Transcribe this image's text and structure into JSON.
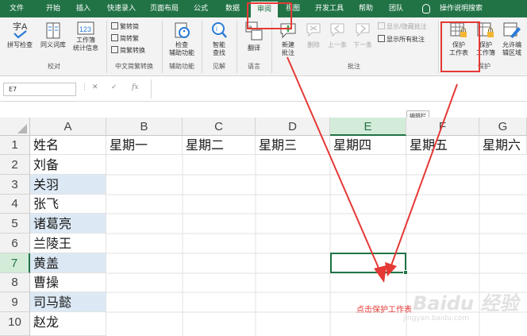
{
  "tabs": [
    {
      "label": "文件"
    },
    {
      "label": "开始"
    },
    {
      "label": "插入"
    },
    {
      "label": "快速录入"
    },
    {
      "label": "页面布局"
    },
    {
      "label": "公式"
    },
    {
      "label": "数据"
    },
    {
      "label": "审阅"
    },
    {
      "label": "视图"
    },
    {
      "label": "开发工具"
    },
    {
      "label": "帮助"
    },
    {
      "label": "团队"
    }
  ],
  "search_label": "操作说明搜索",
  "ribbon": {
    "spellcheck": "拼写检查",
    "thesaurus": "同义词库",
    "wordcount_line1": "工作簿",
    "wordcount_line2": "统计信息",
    "group_proofing": "校对",
    "to_simplified": "繁转简",
    "to_traditional": "简转繁",
    "convert": "简繁转换",
    "group_chinese": "中文简繁转换",
    "check_a11y_line1": "检查",
    "check_a11y_line2": "辅助功能",
    "group_a11y": "辅助功能",
    "smart_lookup_line1": "智能",
    "smart_lookup_line2": "查找",
    "group_insights": "见解",
    "translate": "翻译",
    "group_language": "语言",
    "new_comment_line1": "新建",
    "new_comment_line2": "批注",
    "delete": "删除",
    "prev": "上一条",
    "next": "下一条",
    "show_hide_comment": "显示/隐藏批注",
    "show_all_comments": "显示所有批注",
    "group_comments": "批注",
    "protect_sheet_line1": "保护",
    "protect_sheet_line2": "工作表",
    "protect_wb_line1": "保护",
    "protect_wb_line2": "工作簿",
    "allow_edit_line1": "允许编",
    "allow_edit_line2": "辑区域",
    "group_protect": "保护"
  },
  "formula_bar": {
    "name_box": "E7",
    "cancel": "✕",
    "enter": "✓",
    "fx": "fx",
    "value": ""
  },
  "tooltip": "编辑栏",
  "columns": [
    "A",
    "B",
    "C",
    "D",
    "E",
    "F",
    "G"
  ],
  "rows": [
    "1",
    "2",
    "3",
    "4",
    "5",
    "6",
    "7",
    "8",
    "9",
    "10"
  ],
  "header_row": [
    "姓名",
    "星期一",
    "星期二",
    "星期三",
    "星期四",
    "星期五",
    "星期六"
  ],
  "names": [
    "刘备",
    "关羽",
    "张飞",
    "诸葛亮",
    "兰陵王",
    "黄盖",
    "曹操",
    "司马懿",
    "赵龙"
  ],
  "caption": "点击保护工作表",
  "watermark": "Baidu 经验",
  "watermark_sub": "jingyan.baidu.com",
  "colors": {
    "excel_green": "#217346",
    "highlight_red": "#e53935",
    "name_shade": "#dce9f5"
  }
}
